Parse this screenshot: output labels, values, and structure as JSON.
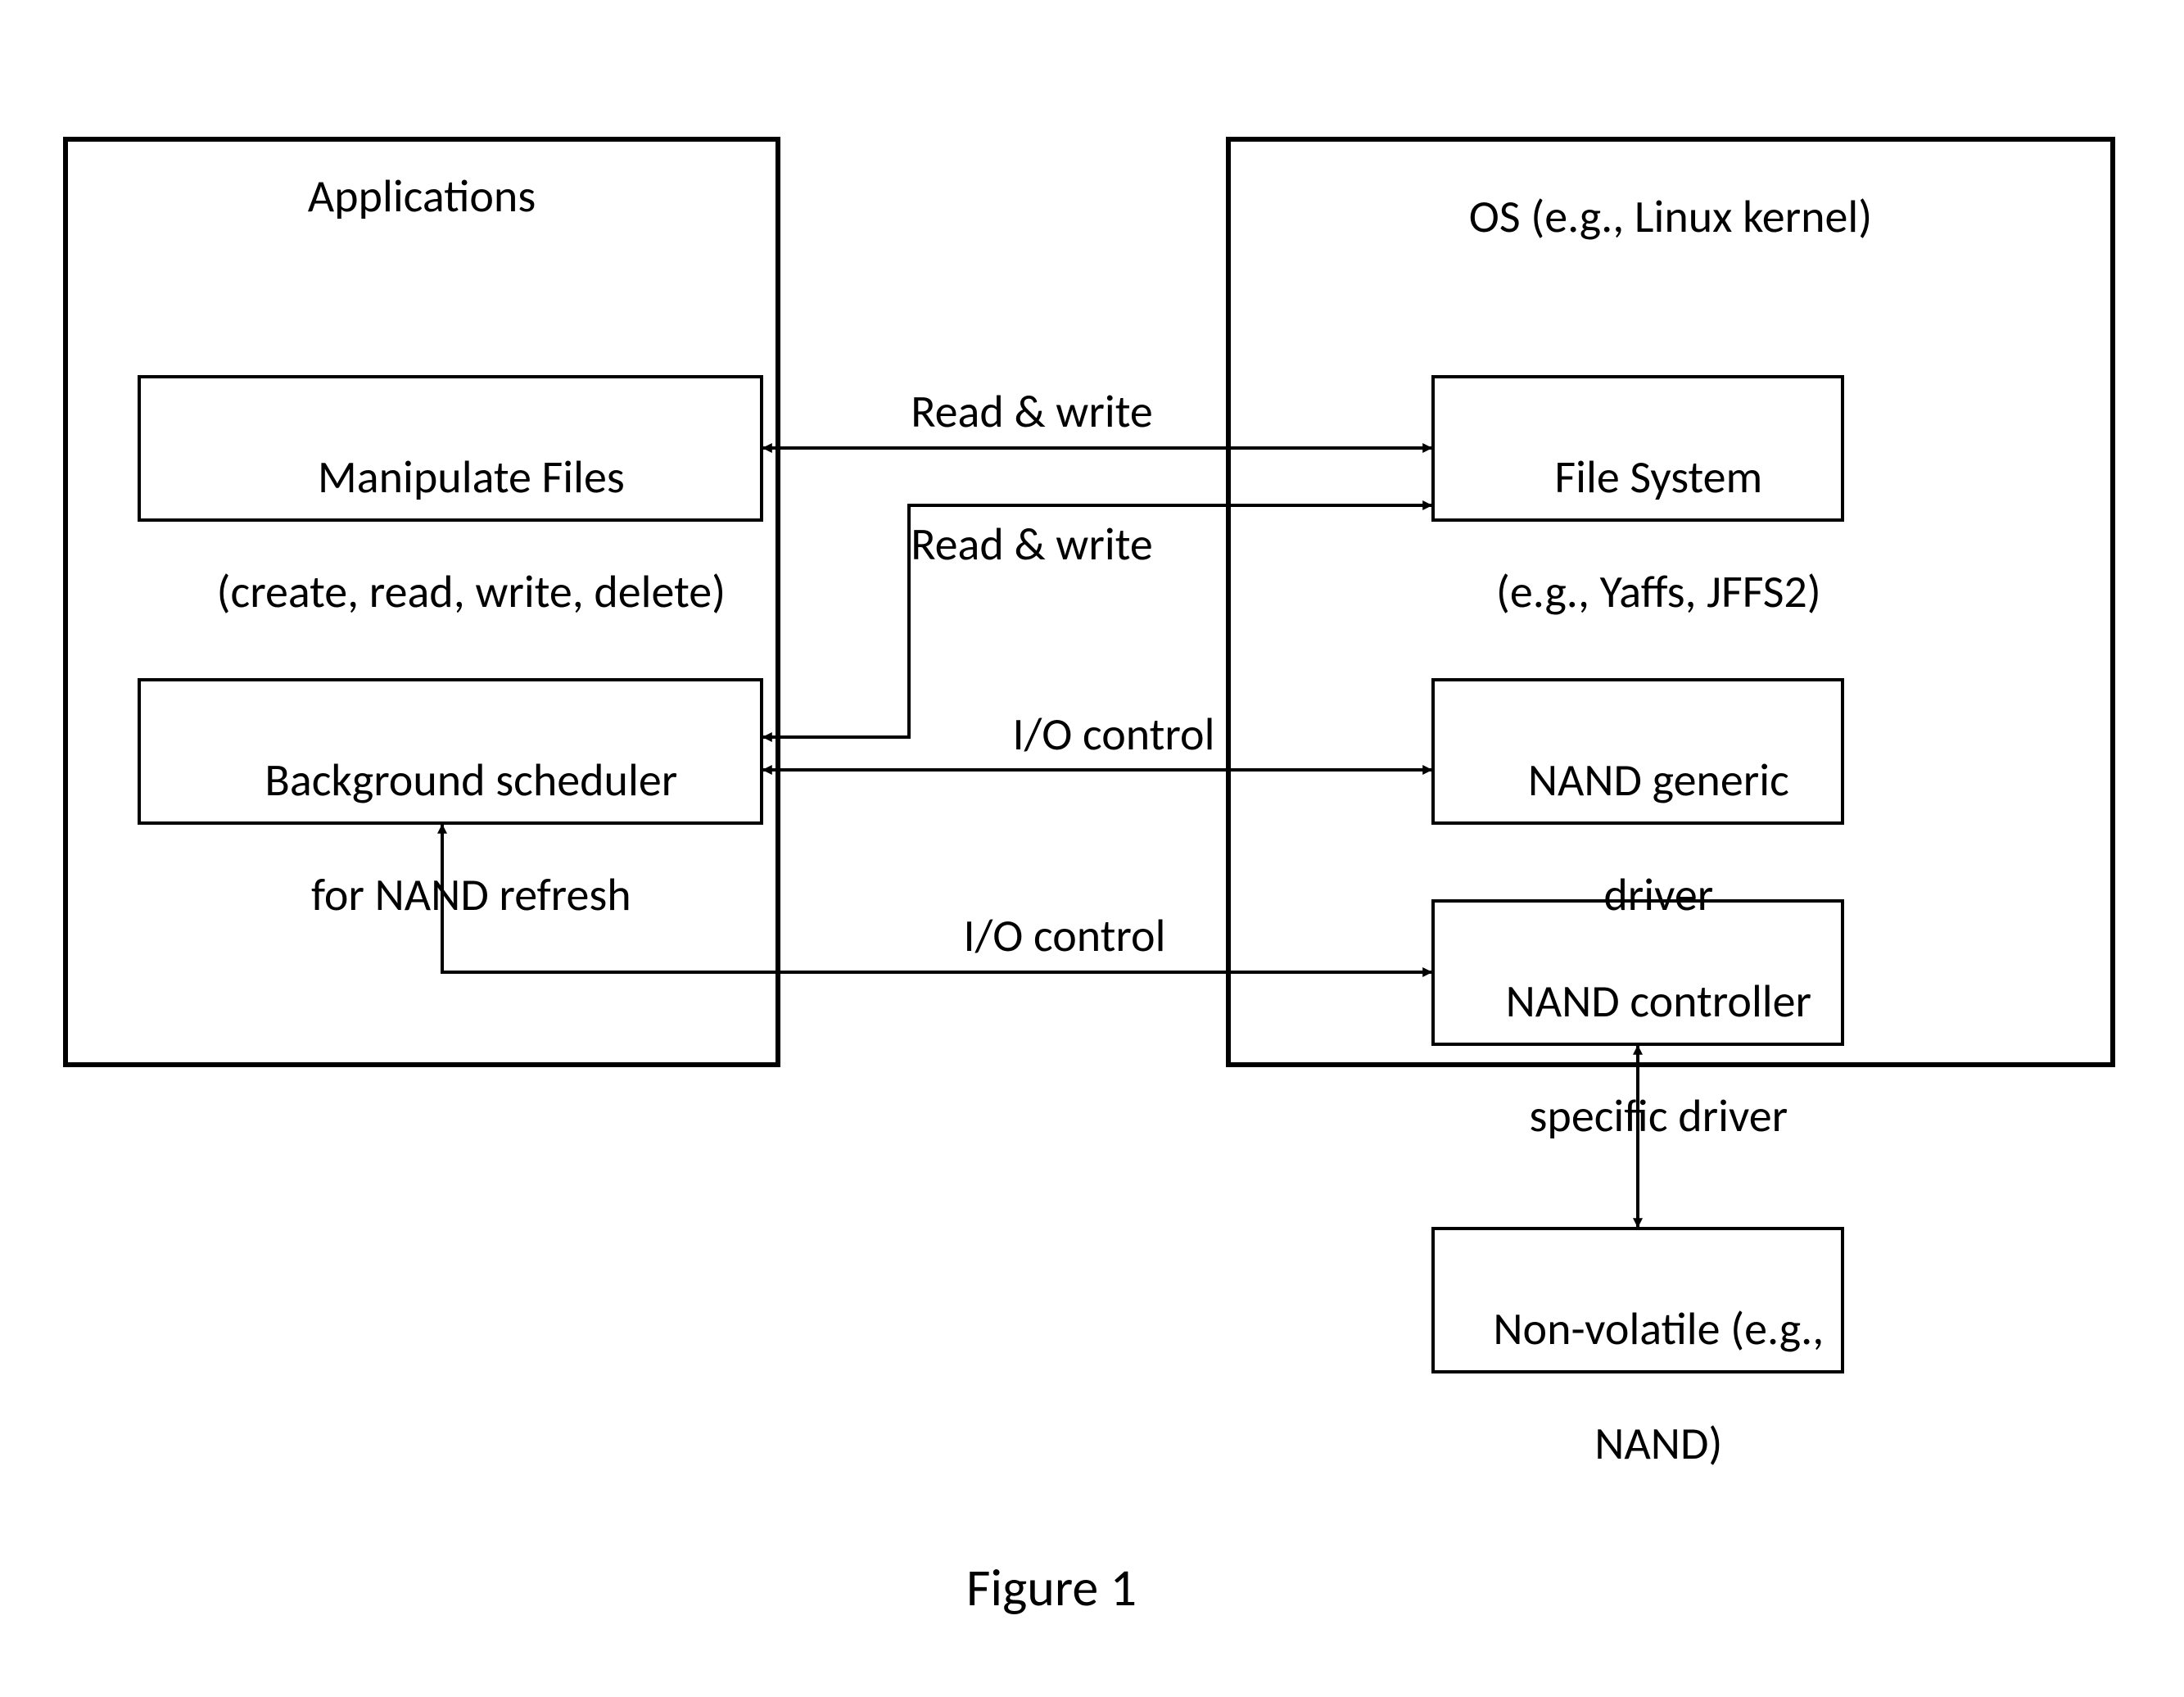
{
  "figure_caption": "Figure 1",
  "groups": {
    "left": {
      "title": "Applications"
    },
    "right": {
      "title": "OS (e.g., Linux kernel)"
    }
  },
  "boxes": {
    "manipulate": {
      "line1": "Manipulate Files",
      "line2": "(create, read, write, delete)"
    },
    "scheduler": {
      "line1": "Background scheduler",
      "line2": "for NAND refresh"
    },
    "filesystem": {
      "line1": "File System",
      "line2": "(e.g., Yaffs, JFFS2)"
    },
    "generic_driver": {
      "line1": "NAND generic",
      "line2": "driver"
    },
    "specific_driver": {
      "line1": "NAND controller",
      "line2": "specific driver"
    },
    "nand": {
      "line1": "Non-volatile (e.g.,",
      "line2": "NAND)"
    }
  },
  "edges": {
    "rw1": "Read & write",
    "rw2": "Read & write",
    "io1": "I/O control",
    "io2": "I/O control"
  }
}
